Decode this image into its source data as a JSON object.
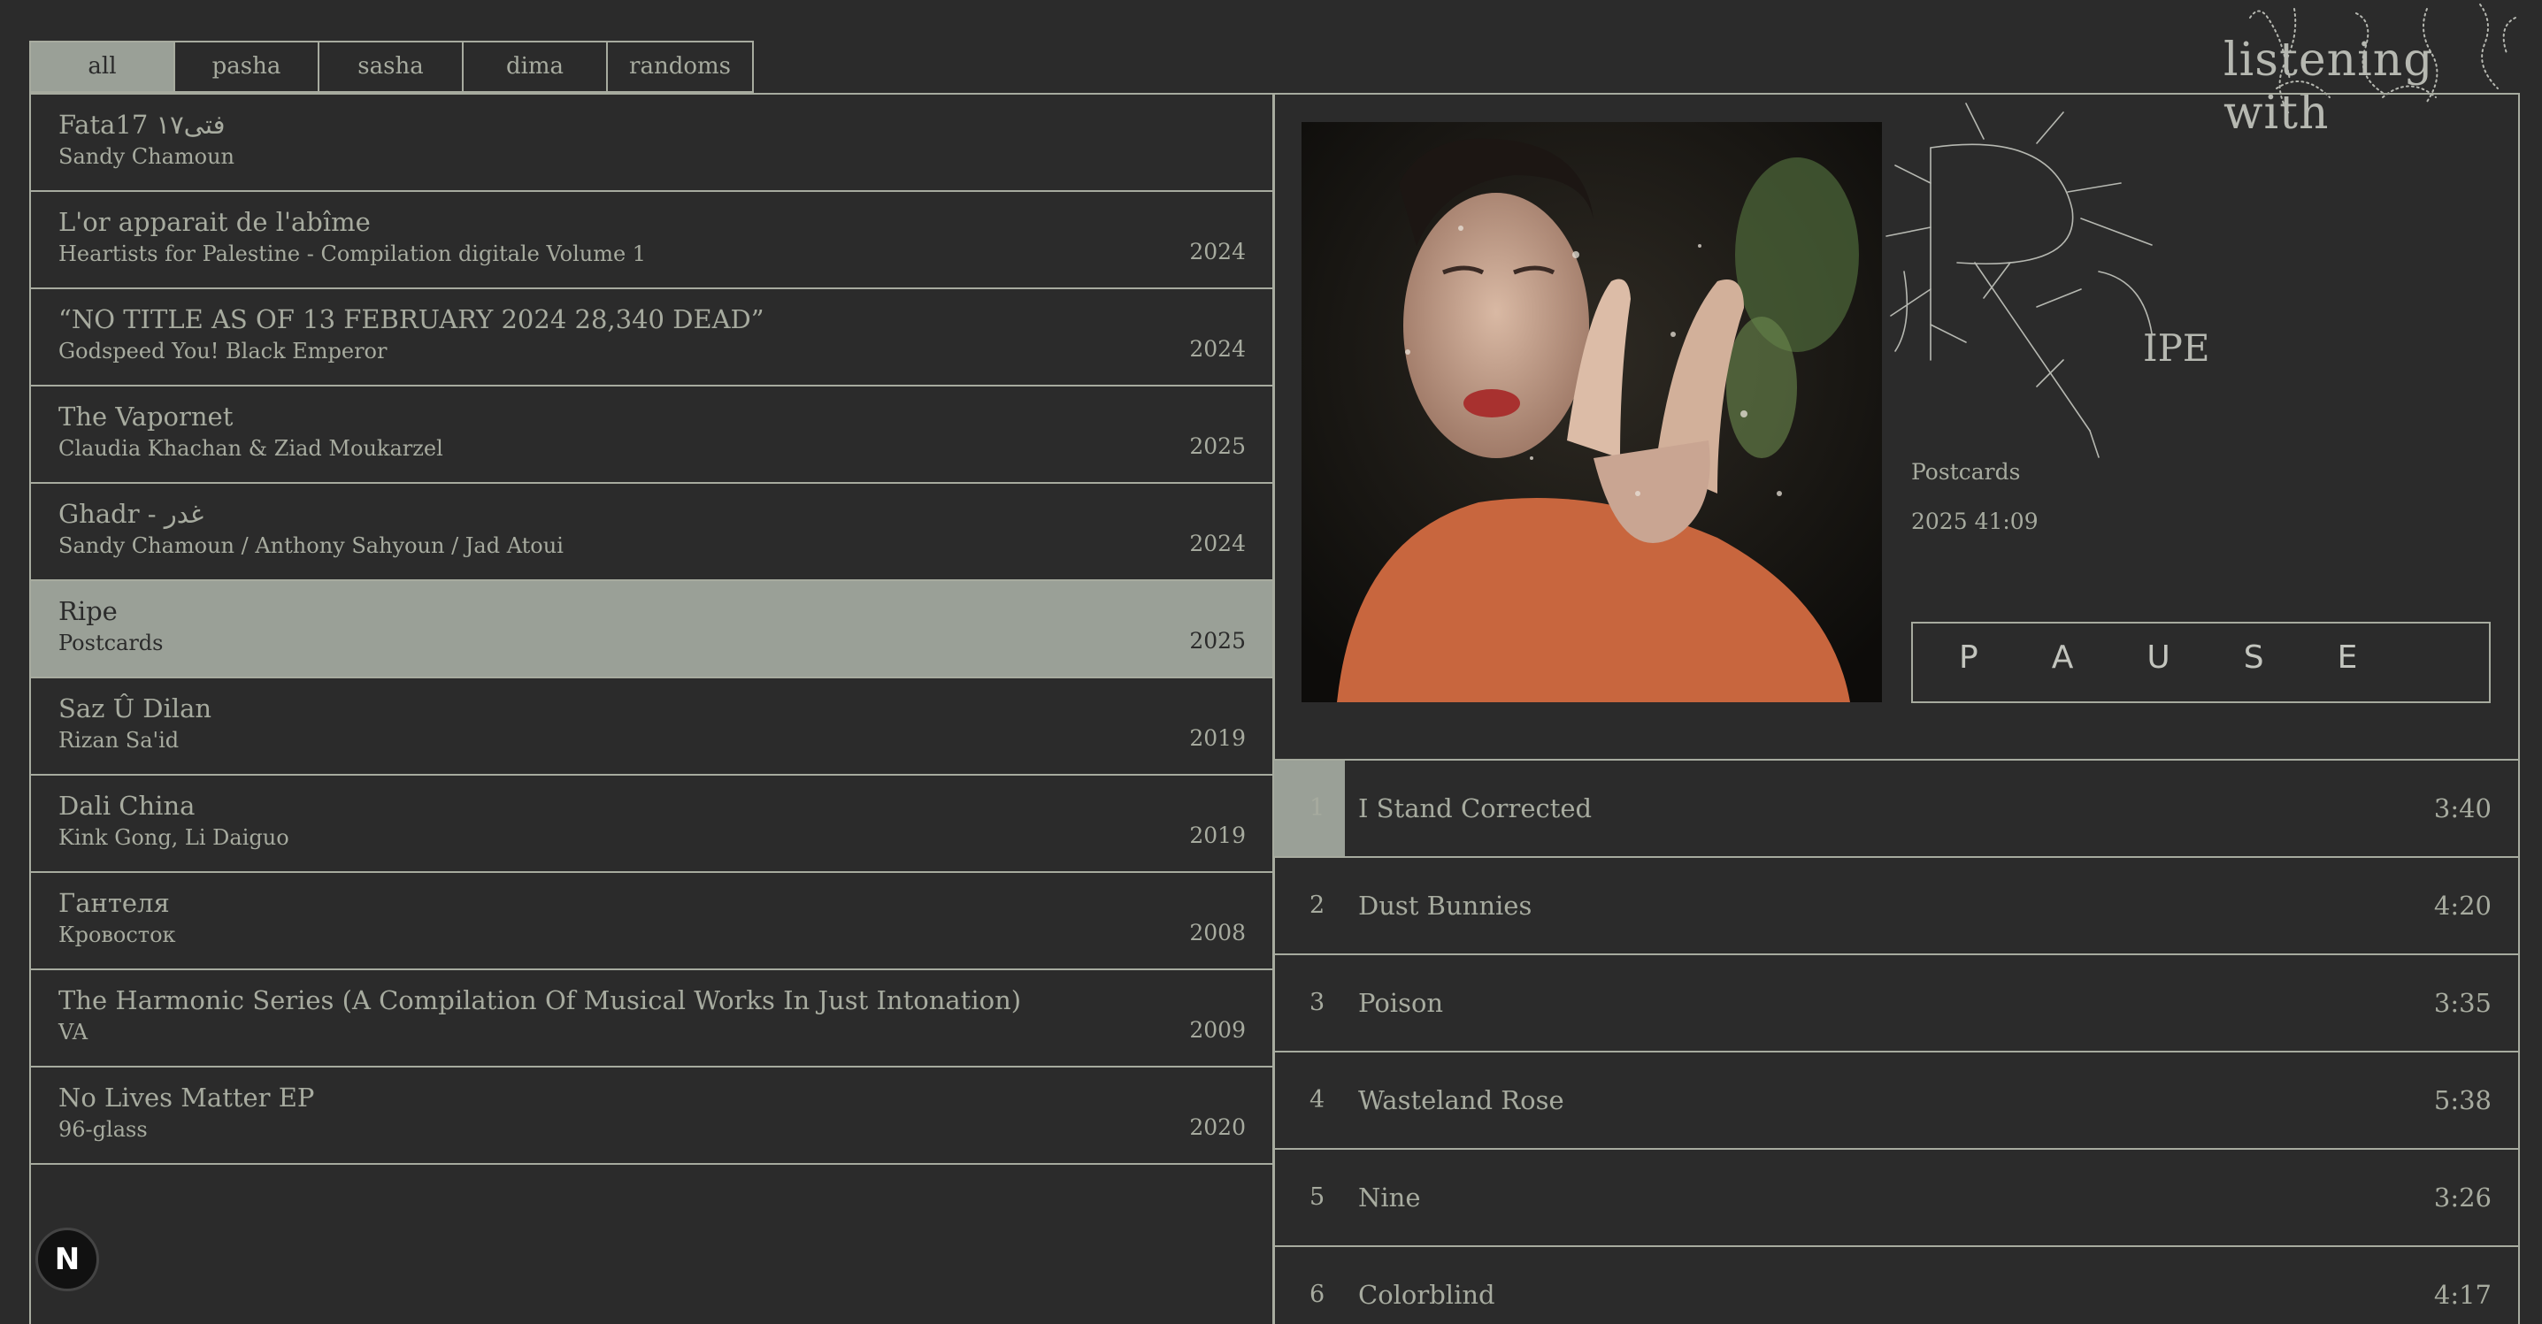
{
  "tabs": [
    {
      "label": "all",
      "active": true
    },
    {
      "label": "pasha",
      "active": false
    },
    {
      "label": "sasha",
      "active": false
    },
    {
      "label": "dima",
      "active": false
    },
    {
      "label": "randoms",
      "active": false
    }
  ],
  "logo": {
    "text": "listening with"
  },
  "albums": [
    {
      "title": "Fata17 فتى١٧",
      "artist": "Sandy Chamoun",
      "year": ""
    },
    {
      "title": "L'or apparait de l'abîme",
      "artist": "Heartists for Palestine - Compilation digitale Volume 1",
      "year": "2024"
    },
    {
      "title": "“NO TITLE AS OF 13 FEBRUARY 2024 28,340 DEAD”",
      "artist": "Godspeed You! Black Emperor",
      "year": "2024"
    },
    {
      "title": "The Vapornet",
      "artist": "Claudia Khachan & Ziad Moukarzel",
      "year": "2025"
    },
    {
      "title": "Ghadr - غدر",
      "artist": "Sandy Chamoun / Anthony Sahyoun / Jad Atoui",
      "year": "2024"
    },
    {
      "title": "Ripe",
      "artist": "Postcards",
      "year": "2025"
    },
    {
      "title": "Saz Û Dilan",
      "artist": "Rizan Sa'id",
      "year": "2019"
    },
    {
      "title": "Dali China",
      "artist": "Kink Gong, Li Daiguo",
      "year": "2019"
    },
    {
      "title": "Гантеля",
      "artist": "Кровосток",
      "year": "2008"
    },
    {
      "title": "The Harmonic Series (A Compilation Of Musical Works In Just Intonation)",
      "artist": "VA",
      "year": "2009"
    },
    {
      "title": "No Lives Matter EP",
      "artist": "96-glass",
      "year": "2020"
    }
  ],
  "selected_album_index": 5,
  "badge": {
    "label": "N"
  },
  "detail": {
    "title_suffix": "IPE",
    "artist": "Postcards",
    "year_duration": "2025 41:09",
    "pause_letters": [
      "P",
      "A",
      "U",
      "S",
      "E"
    ]
  },
  "tracks": [
    {
      "num": "1",
      "title": "I Stand Corrected",
      "duration": "3:40",
      "progress": 0.0571
    },
    {
      "num": "2",
      "title": "Dust Bunnies",
      "duration": "4:20",
      "progress": 0
    },
    {
      "num": "3",
      "title": "Poison",
      "duration": "3:35",
      "progress": 0
    },
    {
      "num": "4",
      "title": "Wasteland Rose",
      "duration": "5:38",
      "progress": 0
    },
    {
      "num": "5",
      "title": "Nine",
      "duration": "3:26",
      "progress": 0
    },
    {
      "num": "6",
      "title": "Colorblind",
      "duration": "4:17",
      "progress": 0
    }
  ],
  "colors": {
    "background": "#2b2b2b",
    "foreground": "#a7ab9f",
    "highlight": "#9aa097"
  }
}
